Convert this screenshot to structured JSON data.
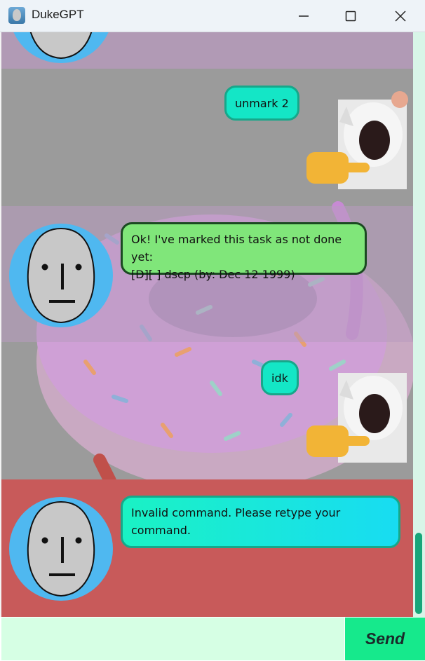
{
  "window": {
    "title": "DukeGPT",
    "controls": [
      "minimize",
      "maximize",
      "close"
    ]
  },
  "messages": [
    {
      "sender": "user",
      "text": "unmark 2",
      "avatar": "cat-pointing-icon"
    },
    {
      "sender": "duke",
      "text": "Ok! I've marked this task as not done yet:\n[D][ ] dscp (by: Dec 12 1999)",
      "avatar": "npc-face-icon"
    },
    {
      "sender": "user",
      "text": "idk",
      "avatar": "cat-pointing-icon"
    },
    {
      "sender": "duke",
      "text": "Invalid command. Please retype your command.",
      "avatar": "npc-face-icon",
      "status": "error"
    }
  ],
  "input": {
    "value": "",
    "placeholder": ""
  },
  "send_button": {
    "label": "Send"
  },
  "colors": {
    "user_bubble": "#14e6c6",
    "duke_bubble": "#80e67a",
    "error_band": "#c85a5a",
    "send_button": "#16e98c",
    "input_bg": "#d6ffe4",
    "scroll_thumb": "#18a67a"
  }
}
